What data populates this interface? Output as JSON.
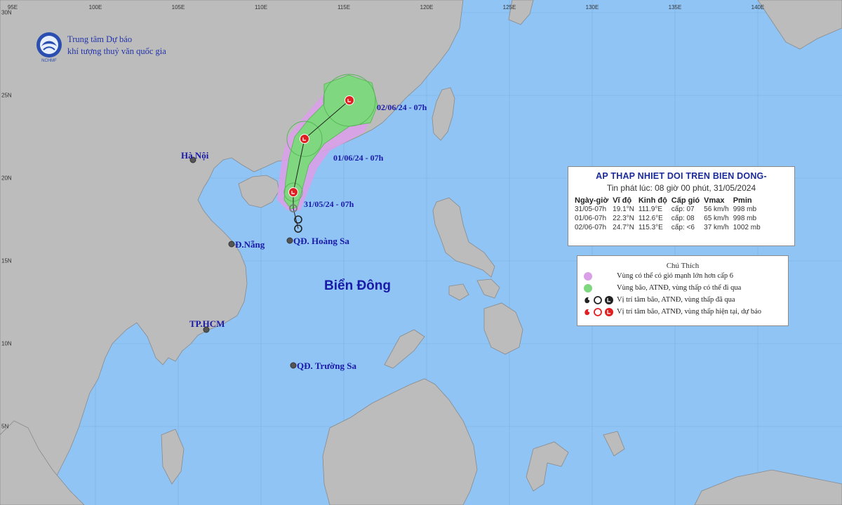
{
  "logo": {
    "line1": "Trung tâm Dự báo",
    "line2": "khí tượng thuỷ văn quốc gia",
    "abbr": "NCHMF"
  },
  "axes": {
    "lon": [
      "95E",
      "100E",
      "105E",
      "110E",
      "115E",
      "120E",
      "125E",
      "130E",
      "135E",
      "140E"
    ],
    "lat": [
      "30N",
      "25N",
      "20N",
      "15N",
      "10N",
      "5N"
    ]
  },
  "places": {
    "hanoi": "Hà Nội",
    "danang": "Đ.Nẵng",
    "hcm": "TP.HCM",
    "hoangsa": "QĐ. Hoàng Sa",
    "truongsa": "QĐ. Trường Sa",
    "sea": "Biển Đông"
  },
  "track_labels": {
    "p1": "31/05/24 - 07h",
    "p2": "01/06/24 - 07h",
    "p3": "02/06/24 - 07h"
  },
  "info_box": {
    "title": "AP THAP NHIET DOI TREN BIEN DONG-",
    "issued": "Tin phát lúc: 08 giờ 00 phút, 31/05/2024",
    "headers": [
      "Ngày-giờ",
      "Vĩ độ",
      "Kinh độ",
      "Cấp gió",
      "Vmax",
      "Pmin"
    ],
    "rows": [
      [
        "31/05-07h",
        "19.1°N",
        "111.9°E",
        "cấp: 07",
        "56 km/h",
        "998 mb"
      ],
      [
        "01/06-07h",
        "22.3°N",
        "112.6°E",
        "cấp: 08",
        "65 km/h",
        "998 mb"
      ],
      [
        "02/06-07h",
        "24.7°N",
        "115.3°E",
        "cấp: <6",
        "37 km/h",
        "1002 mb"
      ]
    ]
  },
  "legend": {
    "title": "Chú Thích",
    "items": [
      {
        "text": "Vùng có thể có gió mạnh lớn hơn cấp 6",
        "color": "#d9a0e8"
      },
      {
        "text": "Vùng bão, ATNĐ, vùng thấp có thể đi qua",
        "color": "#7fd77f"
      },
      {
        "text": "Vị trí tâm bão, ATNĐ, vùng thấp đã qua",
        "color": "#222222"
      },
      {
        "text": "Vị trí tâm bão, ATNĐ, vùng thấp hiện tại, dự báo",
        "color": "#e02020"
      }
    ]
  },
  "colors": {
    "sea": "#8fc4f5",
    "land": "#bcbcbc",
    "risk_wind": "#d9a0e8",
    "risk_track": "#7fd77f",
    "center": "#e02020"
  }
}
